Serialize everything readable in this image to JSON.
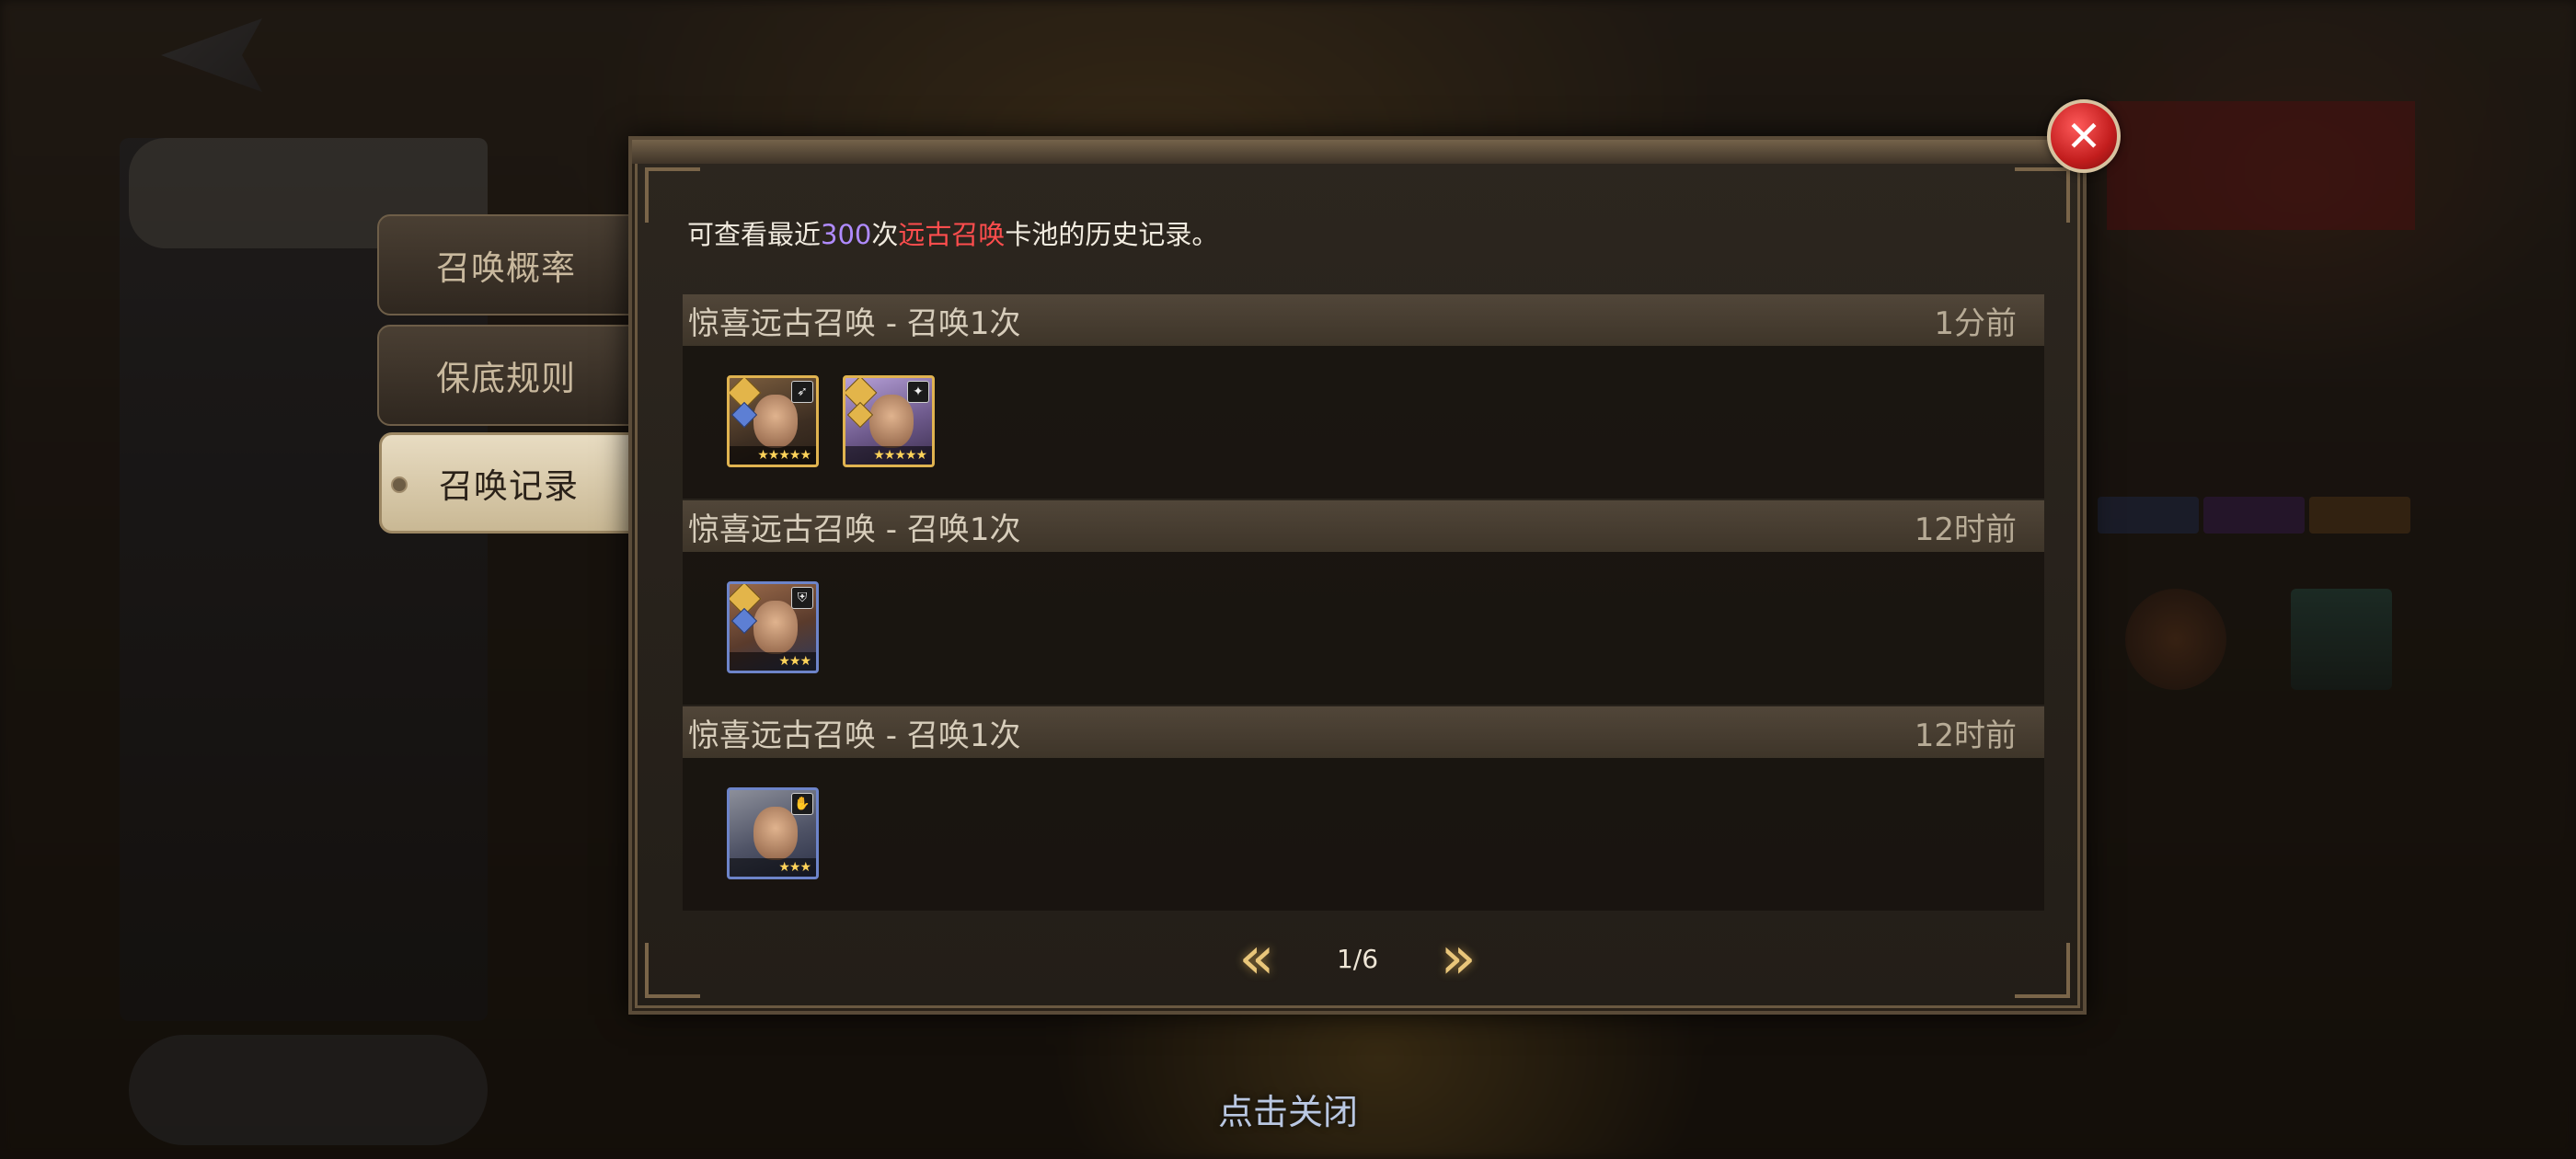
{
  "tabs": [
    {
      "label": "召唤概率"
    },
    {
      "label": "保底规则"
    },
    {
      "label": "召唤记录"
    }
  ],
  "dialog": {
    "info_prefix": "可查看最近",
    "info_count": "300",
    "info_mid": "次",
    "info_pool": "远古召唤",
    "info_suffix": "卡池的历史记录。"
  },
  "records": [
    {
      "title": "惊喜远古召唤 - 召唤1次",
      "time": "1分前",
      "heroes": [
        {
          "frame": "gold",
          "stars": "★★★★★",
          "class_icon": "bow-icon"
        },
        {
          "frame": "gold",
          "stars": "★★★★★",
          "class_icon": "staff-icon"
        }
      ]
    },
    {
      "title": "惊喜远古召唤 - 召唤1次",
      "time": "12时前",
      "heroes": [
        {
          "frame": "blue",
          "stars": "★★★",
          "class_icon": "shield-icon"
        }
      ]
    },
    {
      "title": "惊喜远古召唤 - 召唤1次",
      "time": "12时前",
      "heroes": [
        {
          "frame": "blue",
          "stars": "★★★",
          "class_icon": "hands-icon"
        }
      ]
    }
  ],
  "pager": {
    "prev_icon": "double-chevron-left-icon",
    "next_icon": "double-chevron-right-icon",
    "page": "1/6"
  },
  "close_icon": "close-icon",
  "dismiss_label": "点击关闭"
}
